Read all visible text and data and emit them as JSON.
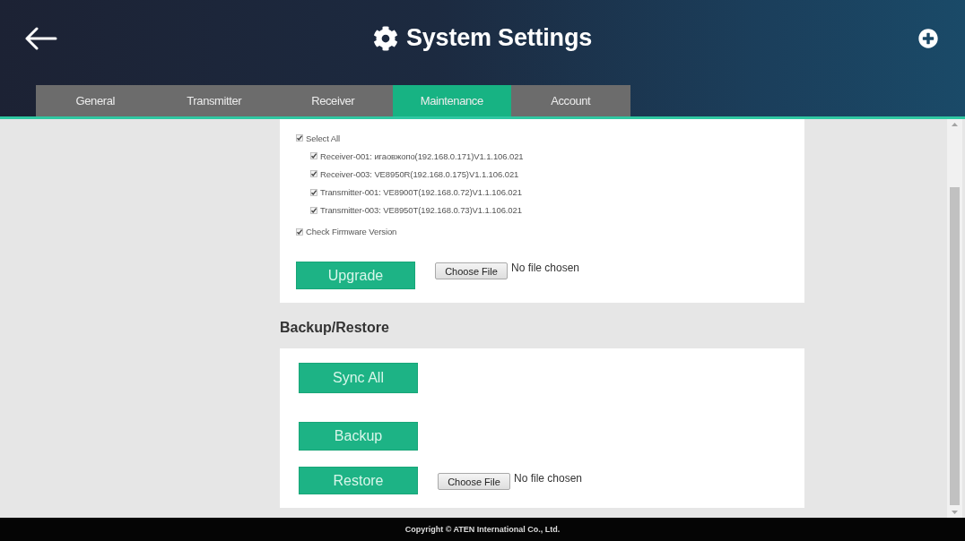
{
  "header": {
    "title": "System Settings"
  },
  "tabs": [
    {
      "label": "General",
      "selected": false
    },
    {
      "label": "Transmitter",
      "selected": false
    },
    {
      "label": "Receiver",
      "selected": false
    },
    {
      "label": "Maintenance",
      "selected": true
    },
    {
      "label": "Account",
      "selected": false
    }
  ],
  "firmware": {
    "select_all": {
      "label": "Select All",
      "checked": true,
      "children": [
        {
          "label": "Receiver-001: игаовжопо(192.168.0.171)V1.1.106.021",
          "checked": true
        },
        {
          "label": "Receiver-003: VE8950R(192.168.0.175)V1.1.106.021",
          "checked": true
        },
        {
          "label": "Transmitter-001: VE8900T(192.168.0.72)V1.1.106.021",
          "checked": true
        },
        {
          "label": "Transmitter-003: VE8950T(192.168.0.73)V1.1.106.021",
          "checked": true
        }
      ]
    },
    "check_version": {
      "label": "Check Firmware Version",
      "checked": true
    },
    "upgrade_button": "Upgrade",
    "file_input": {
      "button": "Choose File",
      "status": "No file chosen"
    }
  },
  "backup_restore": {
    "title": "Backup/Restore",
    "sync_button": "Sync All",
    "backup_button": "Backup",
    "restore_button": "Restore",
    "file_input": {
      "button": "Choose File",
      "status": "No file chosen"
    }
  },
  "footer": {
    "copyright": "Copyright © ATEN International Co., Ltd."
  }
}
